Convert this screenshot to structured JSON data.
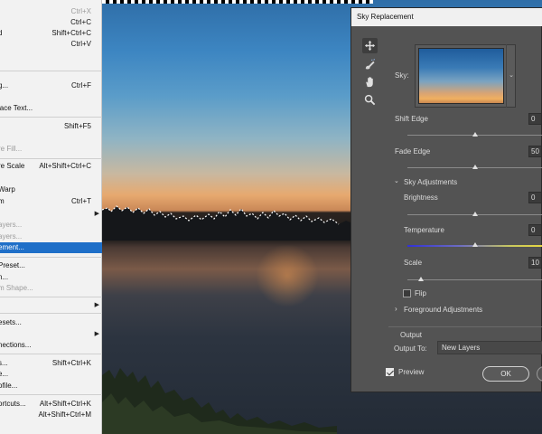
{
  "edit_menu": {
    "items": [
      {
        "label": "",
        "shortcut": "Ctrl+X",
        "disabled": true
      },
      {
        "label": "",
        "shortcut": "Ctrl+C"
      },
      {
        "label": "d",
        "shortcut": "Shift+Ctrl+C"
      },
      {
        "label": "",
        "shortcut": "Ctrl+V"
      },
      {
        "label": "g...",
        "shortcut": "Ctrl+F"
      },
      {
        "label": "lace Text..."
      },
      {
        "label": "",
        "shortcut": "Shift+F5"
      },
      {
        "label": "re Fill...",
        "disabled": true
      },
      {
        "label": "re Scale",
        "shortcut": "Alt+Shift+Ctrl+C"
      },
      {
        "label": "Warp"
      },
      {
        "label": "m",
        "shortcut": "Ctrl+T"
      },
      {
        "label": "ayers...",
        "disabled": true
      },
      {
        "label": "ayers...",
        "disabled": true
      },
      {
        "label": "ement...",
        "highlighted": true
      },
      {
        "label": "Preset..."
      },
      {
        "label": "n..."
      },
      {
        "label": "m Shape...",
        "disabled": true
      },
      {
        "label": "esets..."
      },
      {
        "label": "nections..."
      },
      {
        "label": "s...",
        "shortcut": "Shift+Ctrl+K"
      },
      {
        "label": "e..."
      },
      {
        "label": "ofile..."
      },
      {
        "label": "ortcuts...",
        "shortcut": "Alt+Shift+Ctrl+K"
      },
      {
        "label": "",
        "shortcut": "Alt+Shift+Ctrl+M"
      }
    ]
  },
  "dialog": {
    "title": "Sky Replacement",
    "tools": [
      "move-icon",
      "sky-brush-icon",
      "hand-icon",
      "zoom-icon"
    ],
    "sky_label": "Sky:",
    "shift_edge": {
      "label": "Shift Edge",
      "value": "0",
      "position": 0.5
    },
    "fade_edge": {
      "label": "Fade Edge",
      "value": "50",
      "position": 0.5
    },
    "sky_adjustments": {
      "label": "Sky Adjustments",
      "expanded": true
    },
    "brightness": {
      "label": "Brightness",
      "value": "0",
      "position": 0.5
    },
    "temperature": {
      "label": "Temperature",
      "value": "0",
      "position": 0.5
    },
    "scale": {
      "label": "Scale",
      "value": "10",
      "position": 0.1
    },
    "flip": {
      "label": "Flip",
      "checked": false
    },
    "foreground_adjustments": {
      "label": "Foreground Adjustments",
      "expanded": false
    },
    "output": {
      "section_label": "Output",
      "output_to_label": "Output To:",
      "output_to_value": "New Layers"
    },
    "preview": {
      "label": "Preview",
      "checked": true
    },
    "ok_label": "OK"
  },
  "colors": {
    "menu_highlight": "#1f6fc8",
    "dialog_bg": "#535353",
    "title_bar": "#f0f0f0"
  }
}
